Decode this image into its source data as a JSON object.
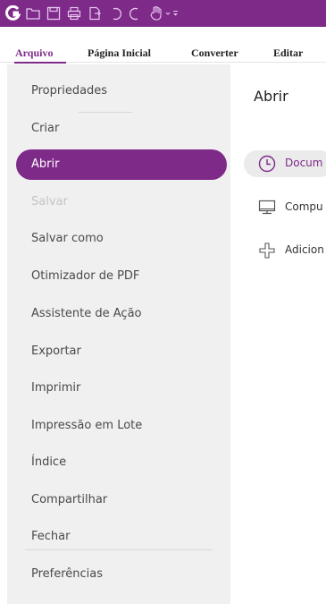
{
  "quick_access": {
    "icons": [
      "app-logo-icon",
      "open-folder-icon",
      "save-icon",
      "print-icon",
      "export-icon",
      "undo-icon",
      "redo-icon",
      "hand-tool-icon",
      "customize-dropdown-icon"
    ]
  },
  "tabs": [
    {
      "label": "Arquivo",
      "active": true
    },
    {
      "label": "Página Inicial",
      "active": false
    },
    {
      "label": "Converter",
      "active": false
    },
    {
      "label": "Editar",
      "active": false
    }
  ],
  "menu": [
    {
      "label": "Propriedades",
      "state": "normal"
    },
    {
      "label": "Criar",
      "state": "normal"
    },
    {
      "label": "Abrir",
      "state": "active"
    },
    {
      "label": "Salvar",
      "state": "disabled"
    },
    {
      "label": "Salvar como",
      "state": "normal"
    },
    {
      "label": "Otimizador de PDF",
      "state": "normal"
    },
    {
      "label": "Assistente de Ação",
      "state": "normal"
    },
    {
      "label": "Exportar",
      "state": "normal"
    },
    {
      "label": "Imprimir",
      "state": "normal"
    },
    {
      "label": "Impressão em Lote",
      "state": "normal"
    },
    {
      "label": "Índice",
      "state": "normal"
    },
    {
      "label": "Compartilhar",
      "state": "normal"
    },
    {
      "label": "Fechar",
      "state": "normal"
    },
    {
      "label": "Preferências",
      "state": "normal"
    }
  ],
  "panel": {
    "title": "Abrir",
    "options": [
      {
        "label": "Docum",
        "icon": "clock-icon",
        "selected": true
      },
      {
        "label": "Compu",
        "icon": "computer-icon",
        "selected": false
      },
      {
        "label": "Adicion",
        "icon": "add-location-icon",
        "selected": false
      }
    ]
  },
  "colors": {
    "accent": "#7d2a88",
    "menu_bg": "#f0f0f0",
    "selected_bg": "#ebebeb"
  }
}
